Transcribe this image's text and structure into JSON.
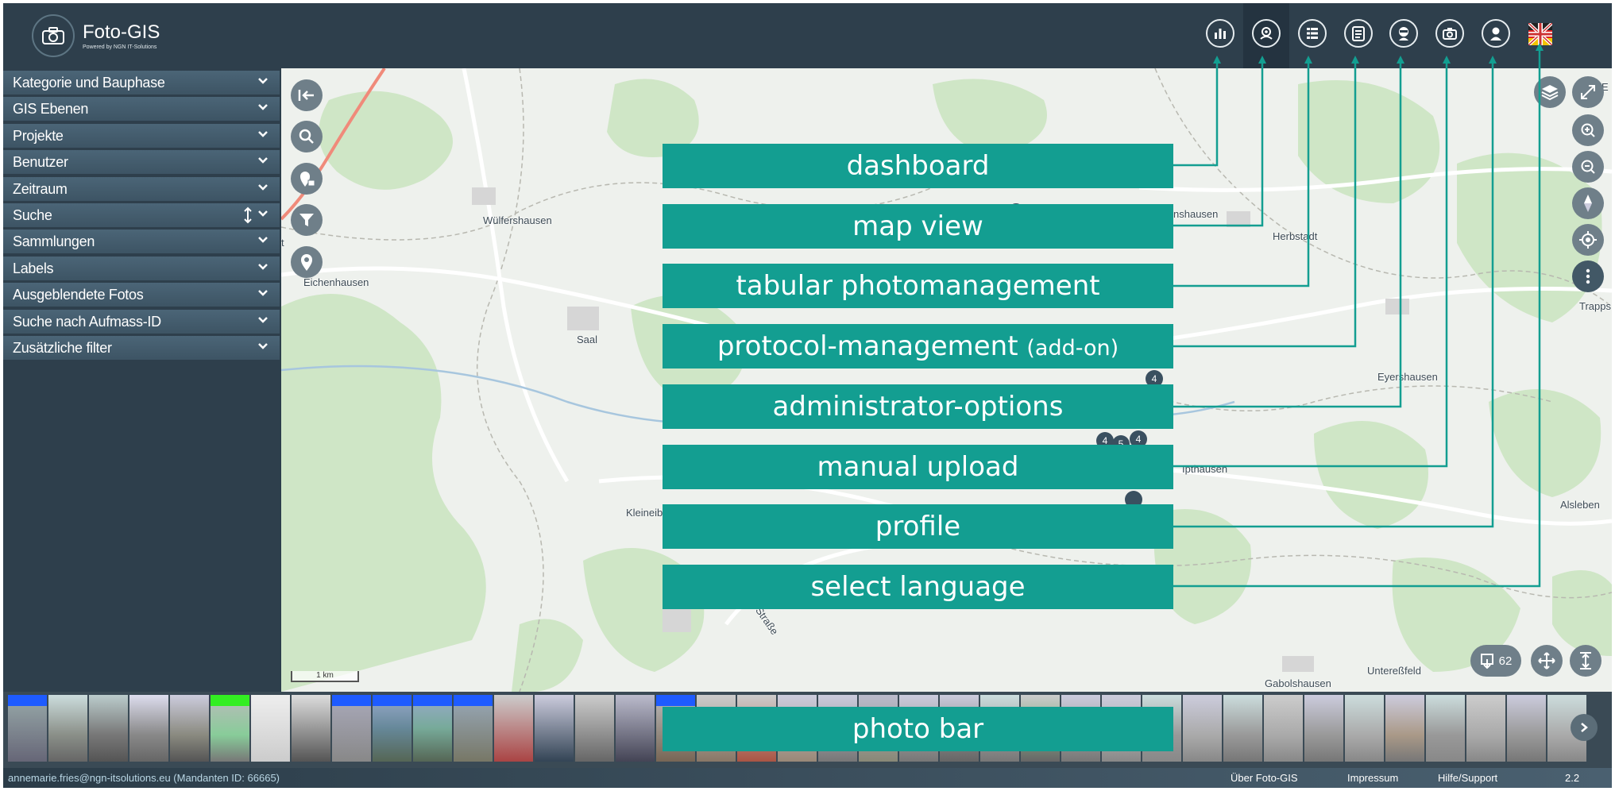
{
  "header": {
    "app_title": "Foto-GIS",
    "app_subtitle": "Powered by NGN IT-Solutions",
    "nav": [
      {
        "name": "dashboard-icon"
      },
      {
        "name": "map-view-icon"
      },
      {
        "name": "tabular-list-icon"
      },
      {
        "name": "protocol-icon"
      },
      {
        "name": "administrator-icon"
      },
      {
        "name": "upload-camera-icon"
      },
      {
        "name": "profile-icon"
      },
      {
        "name": "language-flag-icon"
      }
    ]
  },
  "sidebar": {
    "items": [
      {
        "label": "Kategorie und Bauphase"
      },
      {
        "label": "GIS Ebenen"
      },
      {
        "label": "Projekte"
      },
      {
        "label": "Benutzer"
      },
      {
        "label": "Zeitraum"
      },
      {
        "label": "Suche"
      },
      {
        "label": "Sammlungen"
      },
      {
        "label": "Labels"
      },
      {
        "label": "Ausgeblendete Fotos"
      },
      {
        "label": "Suche nach Aufmass-ID"
      },
      {
        "label": "Zusätzliche filter"
      }
    ]
  },
  "map": {
    "places": {
      "wulfershausen": "Wülfershausen",
      "eichenhausen": "Eichenhausen",
      "saal": "Saal",
      "herbstadt": "Herbstadt",
      "nshausen": "nshausen",
      "eyershausen": "Eyershausen",
      "ipthausen": "Ipthausen",
      "alsleben": "Alsleben",
      "kleineib": "Kleineib",
      "unteressfeld": "Untereßfeld",
      "gabolshausen": "Gabolshausen",
      "trapps": "Trapps",
      "strasse": "er Straße",
      "edge_t": "t",
      "edge_e": "E"
    },
    "clusters": [
      "4",
      "4",
      "5",
      "4"
    ],
    "scale": "1 km",
    "photo_count": "62"
  },
  "annotations": {
    "dashboard": "dashboard",
    "map_view": "map view",
    "tabular": "tabular photomanagement",
    "protocol": "protocol-management",
    "protocol_suffix": "(add-on)",
    "admin": "administrator-options",
    "upload": "manual upload",
    "profile": "profile",
    "language": "select language",
    "photo_bar": "photo bar"
  },
  "footer": {
    "user": "annemarie.fries@ngn-itsolutions.eu (Mandanten ID: 66665)",
    "about": "Über Foto-GIS",
    "imprint": "Impressum",
    "help": "Hilfe/Support",
    "version": "2.2"
  },
  "colors": {
    "accent": "#139e91",
    "header": "#2e3f4c",
    "sidebar_item": "#44596a"
  }
}
